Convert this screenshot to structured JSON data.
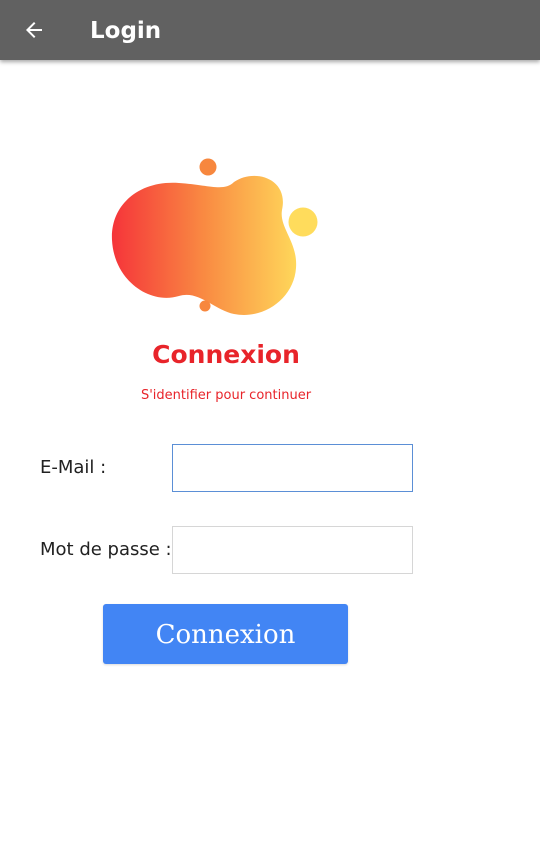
{
  "appbar": {
    "title": "Login",
    "back_icon": "arrow-left-icon",
    "background": "#616161"
  },
  "logo": {
    "icon": "gradient-blob-logo",
    "gradient_start": "#f5343a",
    "gradient_end": "#ffd75a",
    "dot_orange": "#f7873e",
    "dot_yellow": "#ffdc5c"
  },
  "header": {
    "title": "Connexion",
    "subtitle": "S'identifier pour continuer",
    "accent": "#e8242a"
  },
  "form": {
    "email_label": "E-Mail :",
    "email_value": "",
    "password_label": "Mot de passe :",
    "password_value": "",
    "submit_label": "Connexion",
    "submit_color": "#4285f4"
  }
}
